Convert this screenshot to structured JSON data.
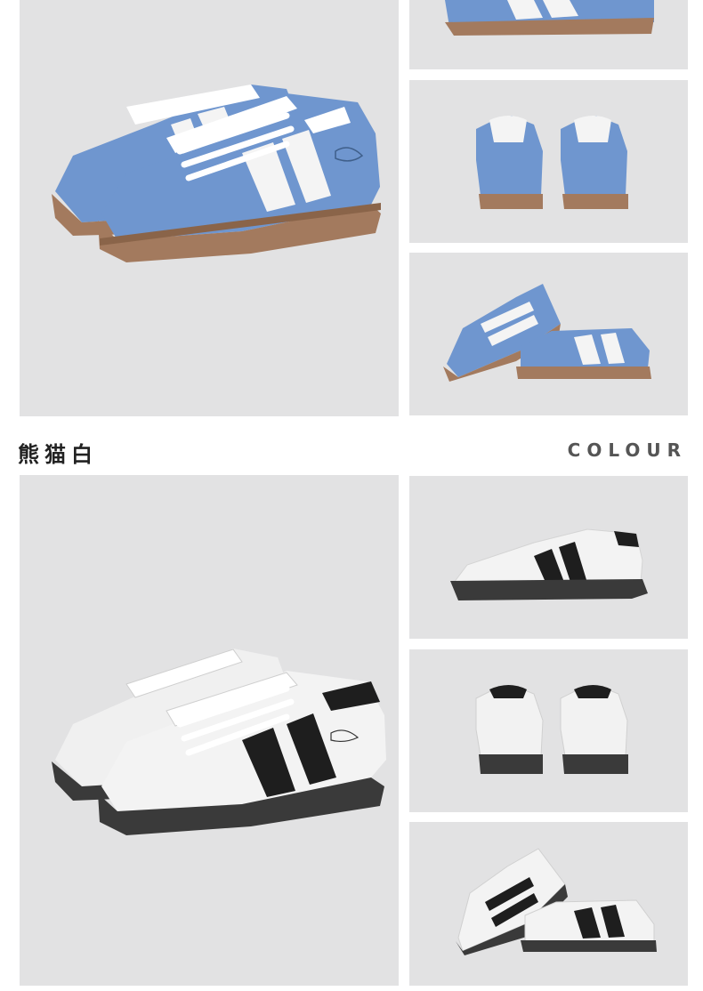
{
  "section": {
    "title_cn": "熊猫白",
    "title_en": "COLOUR"
  },
  "colors": {
    "blue_upper": "#6f96cf",
    "gum_sole": "#a37a5e",
    "white_upper": "#f2f2f2",
    "black_accent": "#222222",
    "panel_bg": "#e2e2e3"
  }
}
